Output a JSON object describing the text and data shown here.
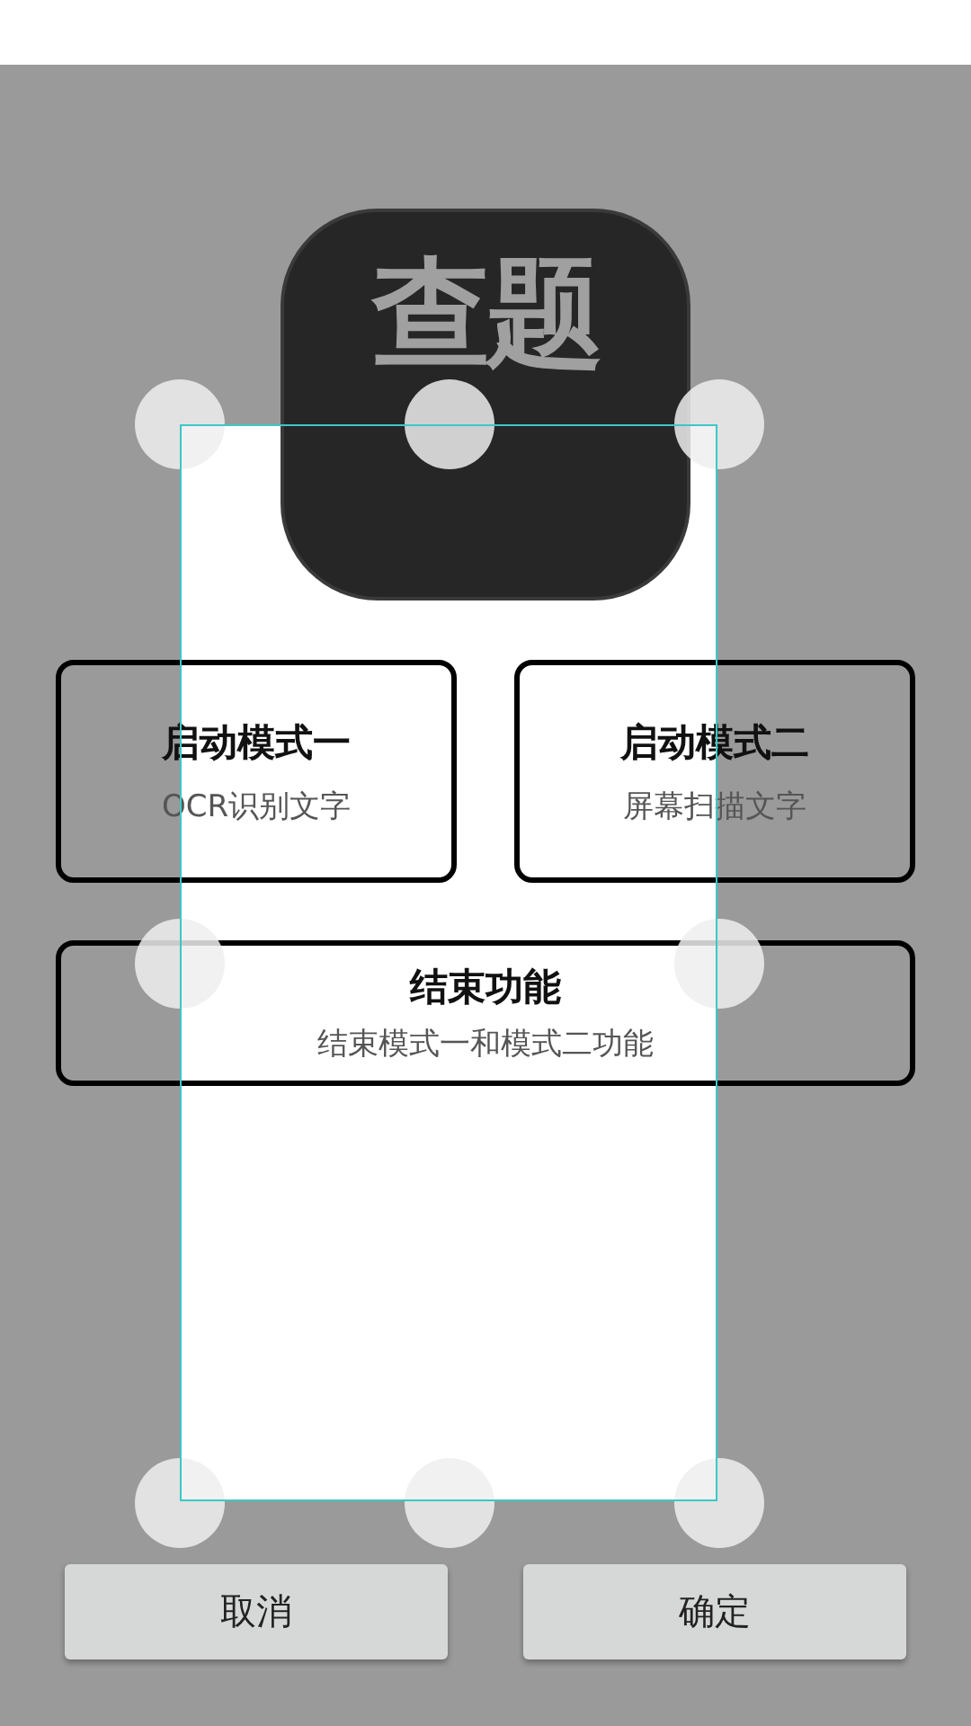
{
  "logo": {
    "text": "查题"
  },
  "mode_cards": [
    {
      "title": "启动模式一",
      "subtitle": "OCR识别文字"
    },
    {
      "title": "启动模式二",
      "subtitle": "屏幕扫描文字"
    }
  ],
  "stop_card": {
    "title": "结束功能",
    "subtitle": "结束模式一和模式二功能"
  },
  "buttons": [
    {
      "label": "取消"
    },
    {
      "label": "确定"
    }
  ]
}
